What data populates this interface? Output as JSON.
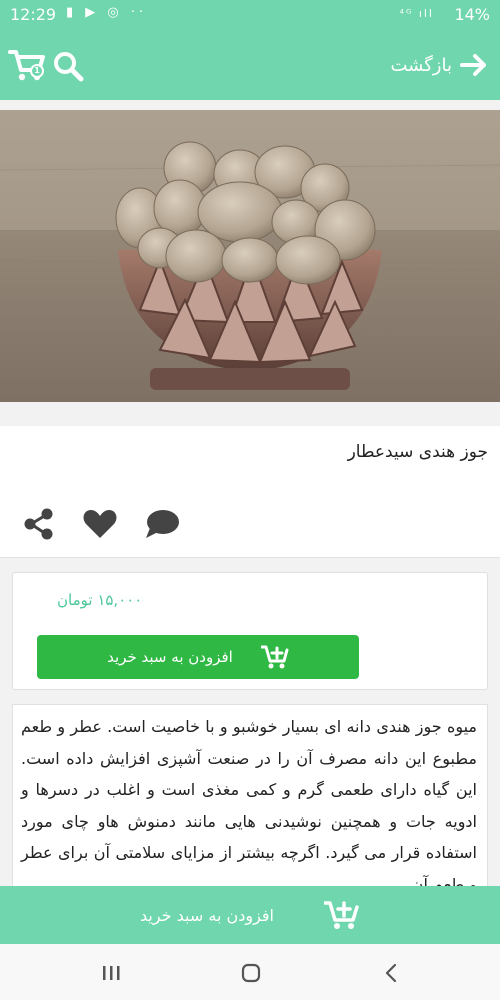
{
  "status_bar": {
    "time": "12:29",
    "left_icons": "▮ ▶ ◎ ··",
    "signal": "⁴ᴳ ıll",
    "battery": "14%"
  },
  "app_bar": {
    "back_label": "بازگشت",
    "cart_count": "1"
  },
  "product": {
    "title": "جوز هندی سیدعطار",
    "price": "۱۵,۰۰۰ تومان",
    "add_to_cart_label": "افزودن به سبد خرید",
    "description": "میوه جوز هندی دانه ای بسیار خوشبو و با خاصیت است. عطر و طعم مطبوع این دانه مصرف آن را در صنعت آشپزی افزایش داده است. این گیاه دارای طعمی گرم و کمی مغذی است و اغلب در دسرها و ادویه جات و همچنین نوشیدنی هایی مانند دمنوش هاو چای  مورد استفاده قرار می گیرد. اگرچه بیشتر از مزایای سلامتی آن برای عطر و طعم آن"
  },
  "bottom_bar": {
    "add_to_cart_label": "افزودن به سبد خرید"
  },
  "colors": {
    "brand": "#6fd6ad",
    "button": "#2fb843",
    "price": "#4cc79a"
  }
}
